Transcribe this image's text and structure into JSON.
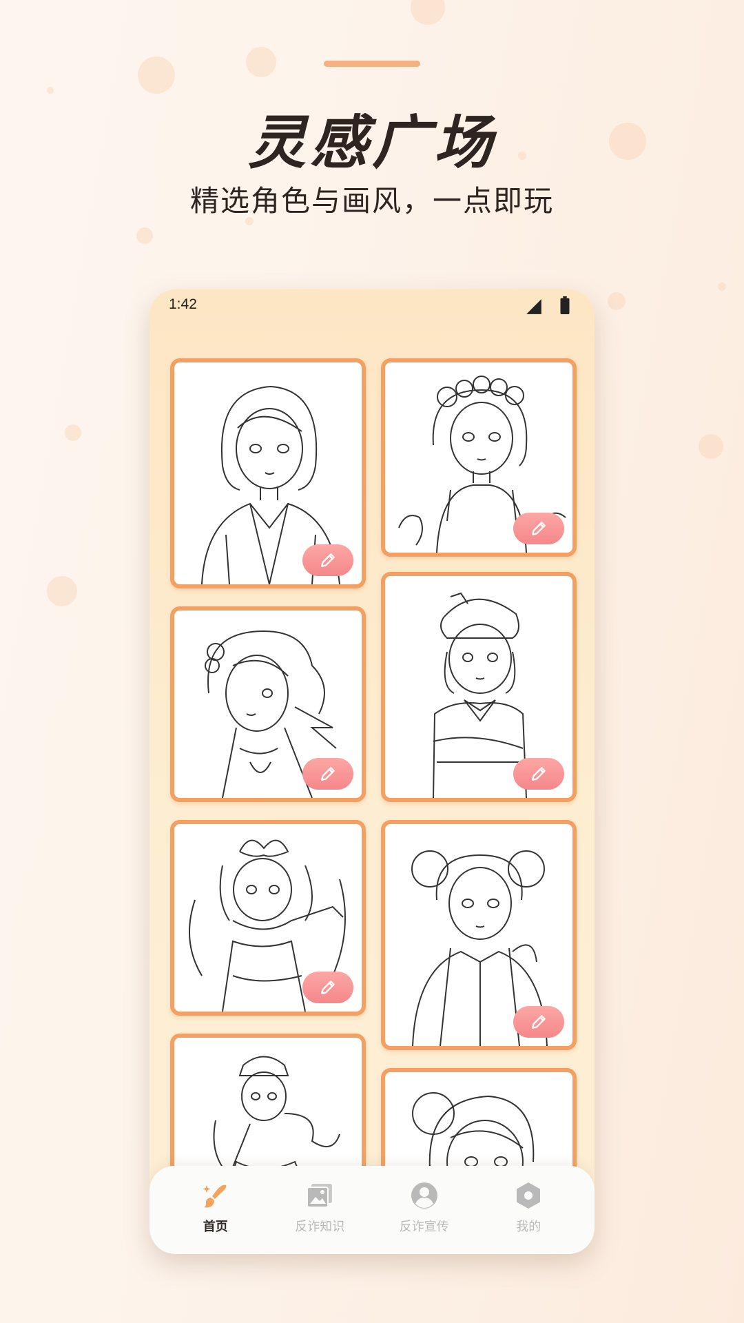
{
  "header": {
    "title": "灵感广场",
    "subtitle": "精选角色与画风，一点即玩"
  },
  "status_bar": {
    "time": "1:42"
  },
  "gallery": {
    "cards": [
      {
        "id": "card-1",
        "subject": "short-hair girl in blazer",
        "has_edit_button": true
      },
      {
        "id": "card-2",
        "subject": "flower crown girl",
        "has_edit_button": true
      },
      {
        "id": "card-3",
        "subject": "side profile girl with ribbon",
        "has_edit_button": true
      },
      {
        "id": "card-4",
        "subject": "girl with beret and bow",
        "has_edit_button": true
      },
      {
        "id": "card-5",
        "subject": "shrine maiden with big bow",
        "has_edit_button": true
      },
      {
        "id": "card-6",
        "subject": "twin buns girl in hoodie",
        "has_edit_button": true
      },
      {
        "id": "card-7",
        "subject": "girl with hat and cape",
        "has_edit_button": false
      },
      {
        "id": "card-8",
        "subject": "girl with hair bun",
        "has_edit_button": false
      }
    ]
  },
  "tab_bar": {
    "items": [
      {
        "label": "首页",
        "icon": "brush-icon",
        "active": true
      },
      {
        "label": "反诈知识",
        "icon": "gallery-icon",
        "active": false
      },
      {
        "label": "反诈宣传",
        "icon": "user-icon",
        "active": false
      },
      {
        "label": "我的",
        "icon": "hexagon-icon",
        "active": false
      }
    ]
  },
  "colors": {
    "card_border": "#f4a062",
    "edit_button": "#f5878a",
    "phone_bg": "#fde6c4",
    "active_tab_icon": "#f5a25c"
  }
}
